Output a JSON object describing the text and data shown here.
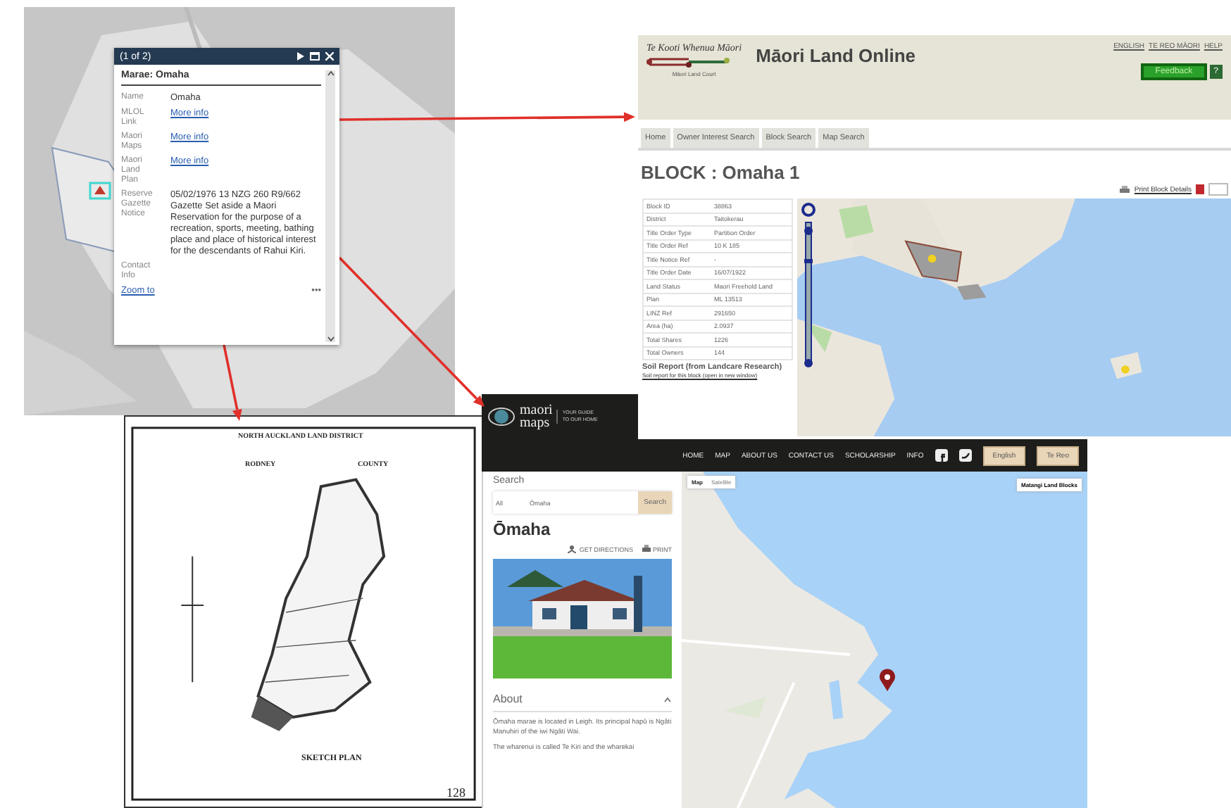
{
  "map_popup": {
    "header": "(1 of 2)",
    "title": "Marae: Omaha",
    "fields": [
      {
        "label": "Name",
        "value": "Omaha",
        "kind": "text"
      },
      {
        "label": "MLOL Link",
        "value": "More info",
        "kind": "link"
      },
      {
        "label": "Maori Maps",
        "value": "More info",
        "kind": "link"
      },
      {
        "label": "Maori Land Plan",
        "value": "More info",
        "kind": "link"
      },
      {
        "label": "Reserve Gazette Notice",
        "value": "05/02/1976 13 NZG 260 R9/662 Gazette Set aside a Maori Reservation for the purpose of a recreation, sports, meeting, bathing place and place of historical interest for the descendants of Rahui Kiri.",
        "kind": "text"
      },
      {
        "label": "Contact Info",
        "kind": "label"
      }
    ],
    "zoom_link": "Zoom to",
    "more": "•••"
  },
  "land_online": {
    "logo_text": "Te Kooti Whenua Māori",
    "logo_sub": "Māori Land Court",
    "title": "Māori Land Online",
    "top_links": [
      "ENGLISH",
      "TE REO MĀORI",
      "HELP"
    ],
    "feedback": "Feedback",
    "help": "?",
    "tabs": [
      "Home",
      "Owner Interest Search",
      "Block Search",
      "Map Search"
    ],
    "heading": "BLOCK : Omaha 1",
    "print_link": "Print Block Details",
    "rows": [
      {
        "label": "Block ID",
        "value": "38863"
      },
      {
        "label": "District",
        "value": "Taitokerau"
      },
      {
        "label": "Title Order Type",
        "value": "Partition Order"
      },
      {
        "label": "Title Order Ref",
        "value": "10 K 185"
      },
      {
        "label": "Title Notice Ref",
        "value": "-"
      },
      {
        "label": "Title Order Date",
        "value": "16/07/1922"
      },
      {
        "label": "Land Status",
        "value": "Maori Freehold Land"
      },
      {
        "label": "Plan",
        "value": "ML 13513"
      },
      {
        "label": "LINZ Ref",
        "value": "291650"
      },
      {
        "label": "Area (ha)",
        "value": "2.0937"
      },
      {
        "label": "Total Shares",
        "value": "1226"
      },
      {
        "label": "Total Owners",
        "value": "144"
      }
    ],
    "soil_heading": "Soil Report (from Landcare Research)",
    "soil_link": "Soil report for this block (open in new window)"
  },
  "survey_plan": {
    "title": "NORTH AUCKLAND LAND DISTRICT",
    "county_left": "RODNEY",
    "county_right": "COUNTY",
    "caption": "SKETCH PLAN",
    "page_number": "128"
  },
  "maori_maps": {
    "logo_top": "maori",
    "logo_bottom": "maps",
    "tagline": "YOUR GUIDE TO OUR HOME",
    "nav": [
      "HOME",
      "MAP",
      "ABOUT US",
      "CONTACT US",
      "SCHOLARSHIP",
      "INFO"
    ],
    "languages": [
      "English",
      "Te Reo"
    ],
    "search_label": "Search",
    "search_scope": "All",
    "search_value": "Ōmaha",
    "search_button": "Search",
    "place": "Ōmaha",
    "directions": "GET DIRECTIONS",
    "print": "PRINT",
    "about": "About",
    "about_expanded": true,
    "paragraphs": [
      "Ōmaha marae is located in Leigh. Its principal hapū is Ngāti Manuhiri of the iwi Ngāti Wai.",
      "The wharenui is called Te Kiri and the wharekai"
    ],
    "map_types": [
      {
        "label": "Map",
        "selected": true
      },
      {
        "label": "Satellite",
        "selected": false
      }
    ],
    "layer_button": "Matangi Land Blocks"
  }
}
